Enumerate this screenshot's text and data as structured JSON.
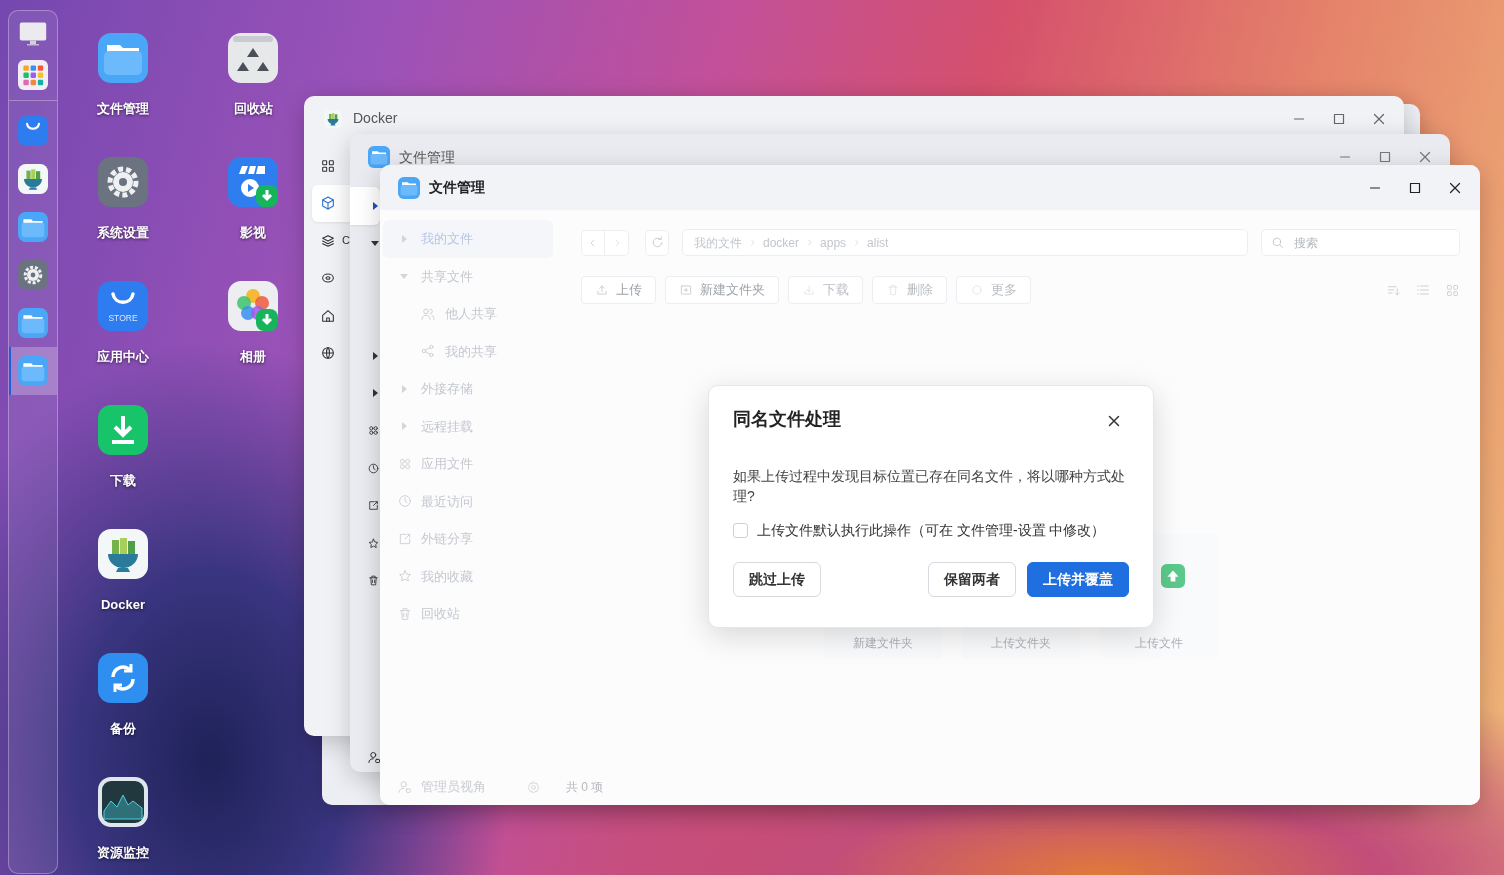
{
  "dock": [
    {
      "kind": "monitor",
      "selected": false
    },
    {
      "kind": "apps",
      "selected": false
    },
    {
      "kind": "store",
      "selected": false
    },
    {
      "kind": "docker",
      "selected": false
    },
    {
      "kind": "files",
      "selected": false
    },
    {
      "kind": "settings",
      "selected": false
    },
    {
      "kind": "files",
      "selected": false
    },
    {
      "kind": "files",
      "selected": true
    }
  ],
  "desktop_icons": [
    {
      "kind": "files",
      "label": "文件管理"
    },
    {
      "kind": "settings",
      "label": "系统设置"
    },
    {
      "kind": "store",
      "label": "应用中心",
      "icon_text": "STORE"
    },
    {
      "kind": "download",
      "label": "下载"
    },
    {
      "kind": "docker",
      "label": "Docker"
    },
    {
      "kind": "backup",
      "label": "备份"
    },
    {
      "kind": "monitor",
      "label": "资源监控"
    },
    {
      "kind": "trash",
      "label": "回收站"
    },
    {
      "kind": "video",
      "label": "影视"
    },
    {
      "kind": "photos",
      "label": "相册"
    }
  ],
  "docker_window": {
    "title": "Docker",
    "sidebar": [
      {
        "kind": "grid",
        "selected": false
      },
      {
        "kind": "cube",
        "selected": true
      },
      {
        "kind": "layers",
        "label": "C",
        "selected": false
      },
      {
        "kind": "disc",
        "selected": false
      },
      {
        "kind": "home",
        "selected": false
      },
      {
        "kind": "globe",
        "selected": false
      }
    ]
  },
  "back_window": {
    "title": "文件管理",
    "sidebar": [
      {
        "kind": "caret",
        "selected": true,
        "expanded": false
      },
      {
        "kind": "caret",
        "selected": false,
        "expanded": true
      },
      {
        "kind": "caret",
        "selected": false,
        "expanded": false
      },
      {
        "kind": "caret",
        "selected": false,
        "expanded": false
      },
      {
        "kind": "apps",
        "selected": false
      },
      {
        "kind": "clock",
        "selected": false
      },
      {
        "kind": "export",
        "selected": false
      },
      {
        "kind": "star",
        "selected": false
      },
      {
        "kind": "trash",
        "selected": false
      }
    ]
  },
  "front_window": {
    "title": "文件管理",
    "sidebar": [
      {
        "kind": "caret",
        "label": "我的文件",
        "selected": true,
        "expanded": false
      },
      {
        "kind": "caret",
        "label": "共享文件",
        "selected": false,
        "expanded": true,
        "children": [
          {
            "kind": "people",
            "label": "他人共享",
            "selected": false
          },
          {
            "kind": "share",
            "label": "我的共享",
            "selected": false
          }
        ]
      },
      {
        "kind": "caret",
        "label": "外接存储",
        "selected": false,
        "expanded": false
      },
      {
        "kind": "caret",
        "label": "远程挂载",
        "selected": false,
        "expanded": false
      },
      {
        "kind": "apps",
        "label": "应用文件",
        "selected": false
      },
      {
        "kind": "clock",
        "label": "最近访问",
        "selected": false
      },
      {
        "kind": "export",
        "label": "外链分享",
        "selected": false
      },
      {
        "kind": "star",
        "label": "我的收藏",
        "selected": false
      },
      {
        "kind": "trash",
        "label": "回收站",
        "selected": false
      }
    ],
    "footer": {
      "label": "管理员视角",
      "count": "共 0 项"
    },
    "breadcrumb": [
      "我的文件",
      "docker",
      "apps",
      "alist"
    ],
    "search": {
      "placeholder": "搜索"
    },
    "toolbar": [
      {
        "kind": "upload",
        "label": "上传",
        "disabled": false
      },
      {
        "kind": "new-folder",
        "label": "新建文件夹",
        "disabled": false
      },
      {
        "kind": "download",
        "label": "下载",
        "disabled": true
      },
      {
        "kind": "delete",
        "label": "删除",
        "disabled": true
      },
      {
        "kind": "more",
        "label": "更多",
        "disabled": true
      }
    ],
    "empty_actions": [
      {
        "kind": "new-folder",
        "label": "新建文件夹"
      },
      {
        "kind": "upload-folder",
        "label": "上传文件夹"
      },
      {
        "kind": "upload-file",
        "label": "上传文件"
      }
    ]
  },
  "dialog": {
    "title": "同名文件处理",
    "message": "如果上传过程中发现目标位置已存在同名文件，将以哪种方式处理?",
    "remember": {
      "label": "上传文件默认执行此操作（可在 文件管理-设置 中修改）",
      "checked": false
    },
    "buttons": [
      {
        "label": "跳过上传",
        "primary": false
      },
      {
        "label": "保留两者",
        "primary": false
      },
      {
        "label": "上传并覆盖",
        "primary": true
      }
    ]
  }
}
